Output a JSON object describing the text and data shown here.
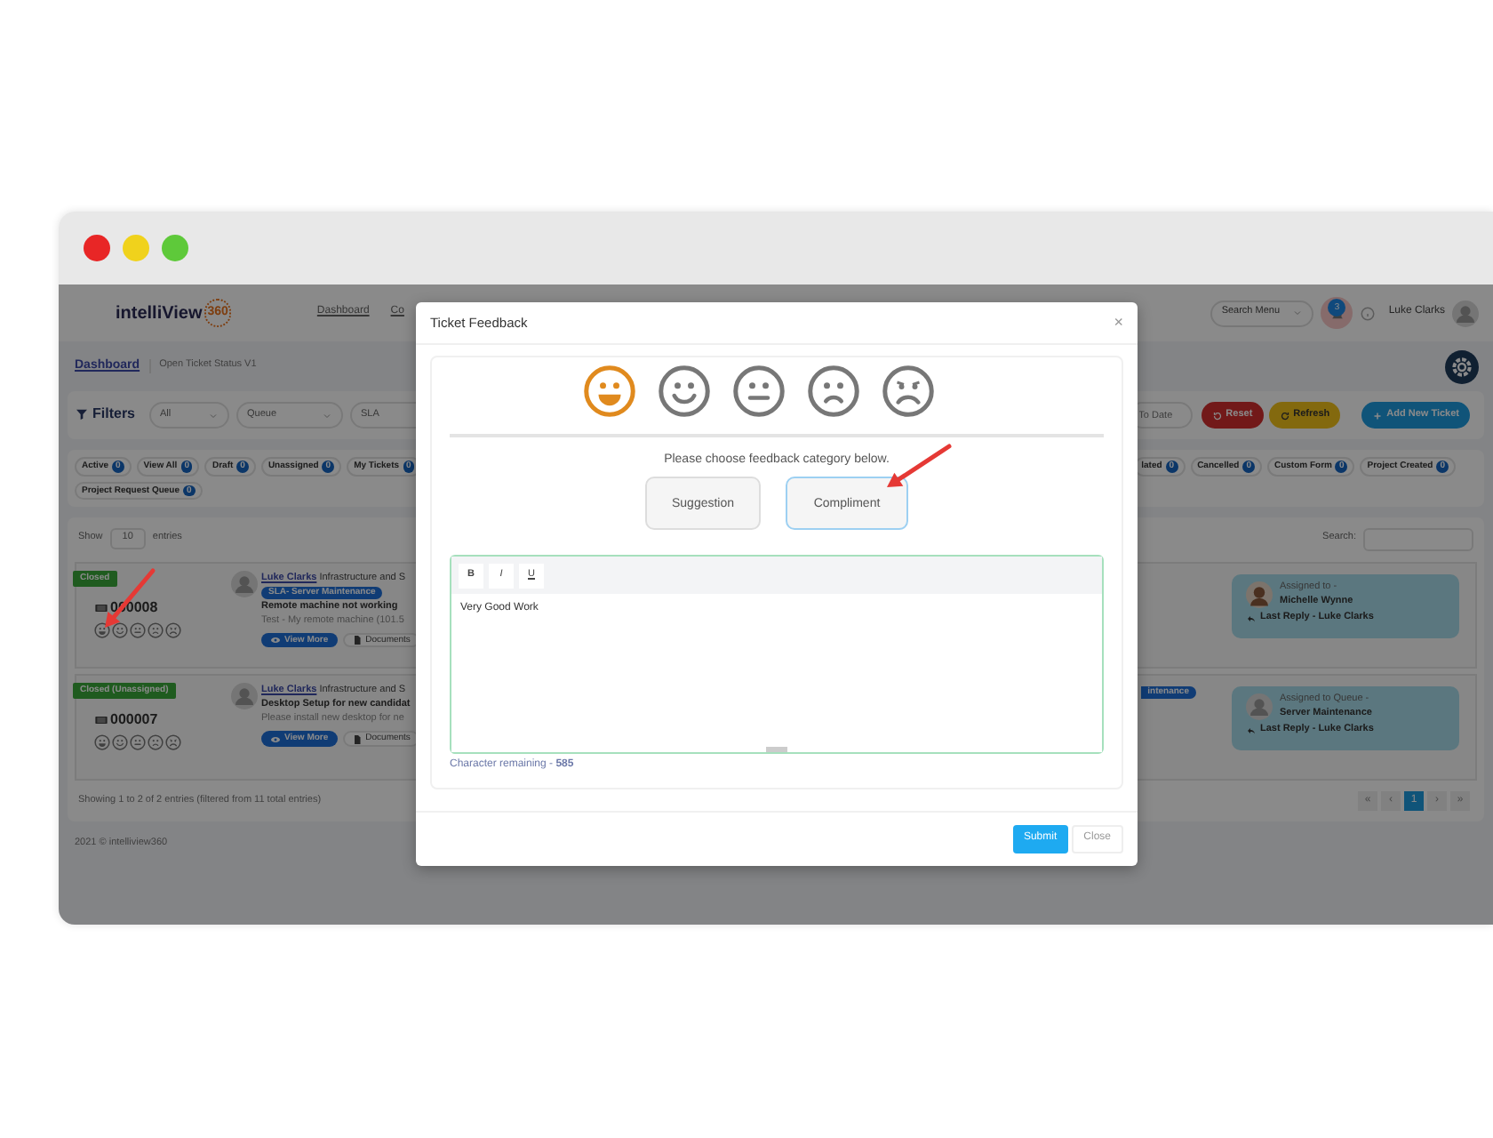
{
  "navbar": {
    "logo_text": "intelliView",
    "logo_badge": "360",
    "nav_links": [
      "Dashboard",
      "Co"
    ],
    "search_menu": {
      "placeholder": "Search Menu"
    },
    "notification_count": "3",
    "user_name": "Luke Clarks"
  },
  "breadcrumb": [
    {
      "label": "Dashboard",
      "link": true
    },
    {
      "label": "Open Ticket Status V1",
      "link": false
    }
  ],
  "filters": {
    "title": "Filters",
    "selects": [
      "All",
      "Queue",
      "SLA"
    ],
    "date_field": {
      "placeholder": "To Date"
    },
    "buttons": [
      {
        "label": "Reset",
        "kind": "reset"
      },
      {
        "label": "Refresh",
        "kind": "refresh"
      },
      {
        "label": "Add New Ticket",
        "kind": "add"
      }
    ]
  },
  "status_chips_left": [
    {
      "label": "Active",
      "count": "0"
    },
    {
      "label": "View All",
      "count": "0"
    },
    {
      "label": "Draft",
      "count": "0"
    },
    {
      "label": "Unassigned",
      "count": "0"
    },
    {
      "label": "My Tickets",
      "count": "0"
    }
  ],
  "status_chips_right": [
    {
      "label": "lated",
      "count": "0"
    },
    {
      "label": "Cancelled",
      "count": "0"
    },
    {
      "label": "Custom Form",
      "count": "0"
    },
    {
      "label": "Project Created",
      "count": "0"
    }
  ],
  "status_chips_second_line": [
    {
      "label": "Project Request Queue",
      "count": "0"
    }
  ],
  "table_controls": {
    "show_label": "Show",
    "page_size": "10",
    "entries_label": "entries",
    "search_label": "Search:"
  },
  "tickets": [
    {
      "status": "Closed",
      "number": "000008",
      "requester": "Luke Clarks",
      "category": "Infrastructure and S",
      "sla_tag": "SLA- Server Maintenance",
      "subject": "Remote machine not working",
      "preview": "Test - My remote machine (101.5",
      "buttons": [
        "View More",
        "Documents"
      ],
      "assigned_label": "Assigned to -",
      "assignee": "Michelle Wynne",
      "kind": "person",
      "last_reply": "Last Reply - Luke Clarks"
    },
    {
      "status": "Closed (Unassigned)",
      "number": "000007",
      "requester": "Luke Clarks",
      "category": "Infrastructure and S",
      "right_tag": "intenance",
      "subject": "Desktop Setup for new candidat",
      "preview": "Please install new desktop for ne",
      "buttons": [
        "View More",
        "Documents"
      ],
      "assigned_label": "Assigned to Queue -",
      "assignee": "Server Maintenance",
      "kind": "queue",
      "last_reply": "Last Reply - Luke Clarks"
    }
  ],
  "entries_info": "Showing 1 to 2 of 2 entries (filtered from 11 total entries)",
  "pagination": [
    {
      "label": "«",
      "selected": false
    },
    {
      "label": "‹",
      "selected": false
    },
    {
      "label": "1",
      "selected": true
    },
    {
      "label": "›",
      "selected": false
    },
    {
      "label": "»",
      "selected": false
    }
  ],
  "footer": "2021 © intelliview360",
  "modal": {
    "title": "Ticket Feedback",
    "close": "×",
    "ratings": [
      {
        "kind": "very-happy",
        "selected": true
      },
      {
        "kind": "happy",
        "selected": false
      },
      {
        "kind": "neutral",
        "selected": false
      },
      {
        "kind": "unhappy",
        "selected": false
      },
      {
        "kind": "very-unhappy",
        "selected": false
      }
    ],
    "prompt": "Please choose feedback category below.",
    "categories": [
      {
        "label": "Suggestion",
        "selected": false
      },
      {
        "label": "Compliment",
        "selected": true
      }
    ],
    "toolbar": [
      "B",
      "I",
      "U"
    ],
    "editor_value": "Very Good Work",
    "char_remaining": "Character remaining - **585**",
    "buttons": [
      {
        "label": "Submit",
        "kind": "primary"
      },
      {
        "label": "Close",
        "kind": "secondary"
      }
    ]
  }
}
